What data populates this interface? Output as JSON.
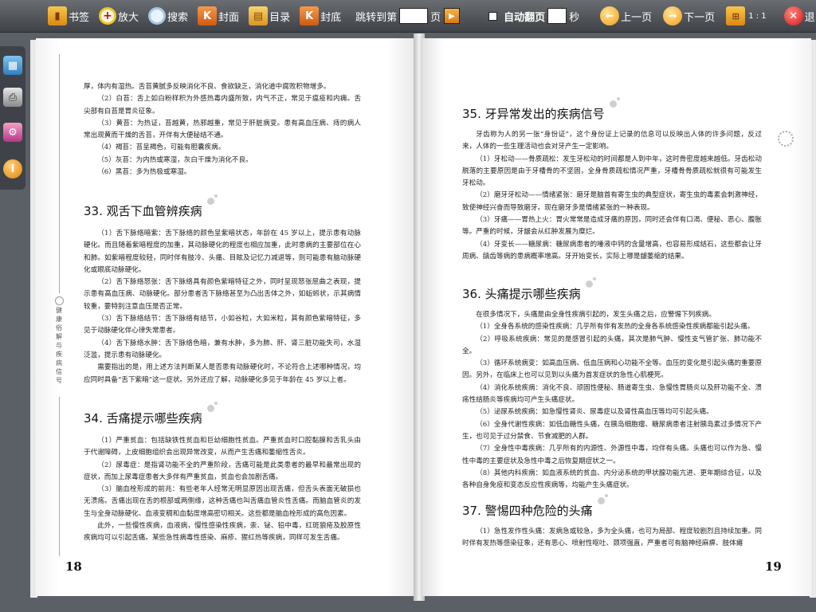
{
  "toolbar": {
    "bookmark": "书签",
    "zoom": "放大",
    "search": "搜索",
    "cover": "封面",
    "contents": "目录",
    "back_cover": "封底",
    "jump_to": "跳转到第",
    "page_unit": "页",
    "auto_flip": "自动翻页",
    "seconds": "秒",
    "prev": "上一页",
    "next": "下一页",
    "ratio": "1 : 1",
    "exit": "退出"
  },
  "book": {
    "vertical_title": "健康俗解与疾病信号",
    "left_page_number": "18",
    "right_page_number": "19",
    "left": {
      "intro_lines": [
        "厚，体内有湿热。舌苔黄腻多反映消化不良、食欲缺乏，消化道中腐败积物增多。",
        "（2）白苔：舌上如白粉样积为外感热毒内盛所致，内气不正，常见于瘟疫和内痈。舌尖部有白苔是胃炎征象。",
        "（3）黄苔：为热证，苔越黄，热邪越重，常见于肝脏病变。患有高血压病、痔的病人常出现黄而干燥的舌苔，开伴有大便秘结不通。",
        "（4）褐苔：苔呈褐色，可能有胆囊疾病。",
        "（5）灰苔：为内热或寒湿，灰白干燥为消化不良。",
        "（6）黑苔：多为热极或寒湿。"
      ],
      "s33": {
        "title": "33.  观舌下血管辨疾病",
        "paras": [
          "（1）舌下脉络暗紫：舌下脉络的颜色呈紫暗状态，年龄在 45 岁以上，提示患有动脉硬化。而且随着紫暗程度的加重，其动脉硬化的程度也相应加重，此时患病的主要部位在心和肺。如紫暗程度较轻，同时伴有肢冷、头痛、目眩及记忆力减退等，则可能患有脑动脉硬化或眼底动脉硬化。",
          "（2）舌下脉络怒张：舌下脉络具有颜色紫暗特征之外，同时呈现怒张屈曲之表现，提示患有高血压病、动脉硬化。部分患者舌下脉络甚至为凸出舌体之外，如蚯蚓状，示其病情较重，要特别注意血压是否正常。",
          "（3）舌下脉络结节：舌下脉络有结节，小如谷粒，大如米粒，其有颜色紫暗特征，多见于动脉硬化伴心律失常患者。",
          "（4）舌下脉络水肿：舌下脉络色暗，兼有水肿，多为肺、肝、肾三脏功能失司，水湿泛滥，提示患有动脉硬化。",
          "需要指出的是，用上述方法判断某人是否患有动脉硬化时，不论符合上述哪种情况，均应同时具备“舌下紫暗”这一症状。另外还应了解，动脉硬化多见于年龄在 45 岁以上者。"
        ]
      },
      "s34": {
        "title": "34.  舌痛提示哪些疾病",
        "paras": [
          "（1）严重贫血：包括缺铁性贫血和巨幼细胞性贫血。严重贫血时口腔黏膜和舌乳头由于代谢障碍，上皮细胞组织会出现异常改变，从而产生舌痛和萎缩性舌炎。",
          "（2）尿毒症：是指肾功能不全的严重阶段，舌痛可能是此类患者的最早和最常出现的症状，而加上尿毒症患者大多伴有严重贫血，贫血也会加剧舌痛。",
          "（3）脑血栓形成的前兆：有些老年人经常无明显原因出现舌痛，但舌头表面无破损也无溃疡。舌痛出现在舌的根部或两侧缘，这种舌痛也叫舌痛血管炎性舌痛。而脑血管炎的发生与全身动脉硬化、血液变稠和血黏度增高密切相关。这些都是脑血栓形成的高危因素。",
          "此外，一些慢性疾病，血液病，慢性感染性疾病，汞、铋、铅中毒，红斑狼疮及胶原性疾病均可以引起舌痛。某些急性病毒性感染、麻疹、猩红热等疾病，同样可发生舌痛。"
        ]
      }
    },
    "right": {
      "s35": {
        "title": "35.  牙异常发出的疾病信号",
        "paras": [
          "牙齿称为人的另一张“身份证”，这个身份证上记录的信息可以反映出人体的许多问题，反过来，人体的一些生理活动也会对牙产生一定影响。",
          "（1）牙松动——骨质疏松：发生牙松动的时间都是人到中年，这时骨密度越来越低。牙齿松动脱落的主要原因是由于牙槽骨的不坚固，全身骨质疏松情况严重，牙槽骨骨质疏松就很有可能发生牙松动。",
          "（2）磨牙牙松动——情绪紧张：磨牙是脑首有寄生虫的典型症状，寄生虫的毒素会刺激神经，致使神经兴奋而导致磨牙。现在磨牙多是情绪紧张的一种表现。",
          "（3）牙痛——胃热上火：胃火常常是造成牙痛的原因，同时还会伴有口渴、便秘、恶心、腹胀等。严重的时候，牙龈会从红肿发展为糜烂。",
          "（4）牙变长——糖尿病：糖尿病患者的唾液中钙的含量增高，也容易形成结石，这些都会让牙周病、龋齿等病的患病概率增高。牙开始变长，实际上哪是龈萎缩的结果。"
        ]
      },
      "s36": {
        "title": "36.  头痛提示哪些疾病",
        "paras": [
          "在很多情况下，头痛是由全身性疾病引起的，发生头痛之后，应警惕下列疾病。",
          "（1）全身各系统的感染性疾病：几乎所有伴有发热的全身各系统感染性疾病都能引起头痛。",
          "（2）呼吸系统疾病：常见的是感冒引起的头痛，其次是肺气肿、慢性支气管扩张、肺功能不全。",
          "（3）循环系统病变：如高血压病、低血压病和心功能不全等。血压的变化是引起头痛的重要原因。另外，在临床上也可以见到以头痛为首发症状的急性心肌梗死。",
          "（4）消化系统疾病：消化不良、顽固性便秘、肠道寄生虫、急慢性胃肠炎以及肝功能不全、溃疡性结肠炎等疾病均可产生头痛症状。",
          "（5）泌尿系统疾病：如急慢性肾炎、尿毒症以及肾性高血压等均可引起头痛。",
          "（6）全身代谢性疾病：如低血糖性头痛，在胰岛细胞瘤、糖尿病患者注射胰岛素过多情况下产生，也可见于过分禁食、节食减肥的人群。",
          "（7）全身性中毒疾病：几乎所有的内源性、外源性中毒，均伴有头痛。头痛也可以作为急、慢性中毒的主要症状及急性中毒之后恢复期症状之一。",
          "（8）其他内科疾病：如血液系统的贫血、内分泌系统的甲状腺功能亢进、更年期综合征，以及各种自身免疫和变态反应性疾病等，均能产生头痛症状。"
        ]
      },
      "s37": {
        "title": "37.  警惕四种危险的头痛",
        "paras": [
          "（1）急性发作性头痛：发病急或较急，多为全头痛，也可为局部、程度较剧烈且持续加重。同时伴有发热等感染征象，还有恶心、喷射性呕吐、颈项强直，严重者可有脑神经麻痹、肢体瘫"
        ]
      }
    }
  }
}
